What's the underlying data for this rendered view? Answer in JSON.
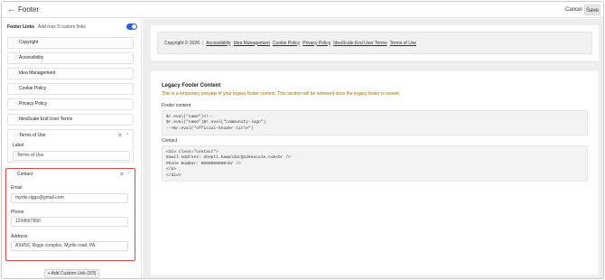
{
  "header": {
    "back_label": "Footer",
    "cancel_label": "Cancel",
    "save_label": "Save"
  },
  "left": {
    "section_title": "Footer Links",
    "section_subtitle": "Add max 3 custom links",
    "toggle_on": true,
    "links": [
      {
        "label": "Copyright"
      },
      {
        "label": "Accessibility"
      },
      {
        "label": "Idea Management"
      },
      {
        "label": "Cookie Policy"
      },
      {
        "label": "Privacy Policy"
      },
      {
        "label": "IdeaScale End User Terms"
      }
    ],
    "terms": {
      "title": "Terms of Use",
      "label_caption": "Label",
      "label_value": "Terms of Use"
    },
    "contact": {
      "title": "Contact",
      "email_caption": "Email",
      "email_value": "myrtle.riggs@gmail.com",
      "phone_caption": "Phone",
      "phone_value": "1234567890",
      "address_caption": "Address",
      "address_value": "A34/56, Riggs complex, Myrtle road, PA."
    },
    "add_custom_label": "+ Add Custom Link (0/3)"
  },
  "right": {
    "preview": {
      "copyright": "Copyright © 2026",
      "links": [
        "Accessibility",
        "Idea Management",
        "Cookie Policy",
        "Privacy Policy",
        "IdeaScale End User Terms",
        "Terms of Use"
      ]
    },
    "legacy": {
      "title": "Legacy Footer Content",
      "note": "This is a temporary preview of your legacy footer content. This section will be removed once the legacy footer is sunset.",
      "footer_content_label": "Footer content",
      "footer_content_code": "$r.eval(\"name\")<!--\n$r.eval(\"name\")$r.eval(\"community-logo\")\n-->$r.eval(\"official-header-title\")",
      "contact_label": "Contact",
      "contact_code": "<div class=\"contact\">\nEmail Address: deepti.hawaldar@ideascale.com<br />\nPhone Number: 0000000000<br />\n</p>\n</div>"
    }
  },
  "colors": {
    "accent": "#2f5fd7",
    "warning_text": "#9a6a12",
    "highlight_border": "#e04545"
  }
}
